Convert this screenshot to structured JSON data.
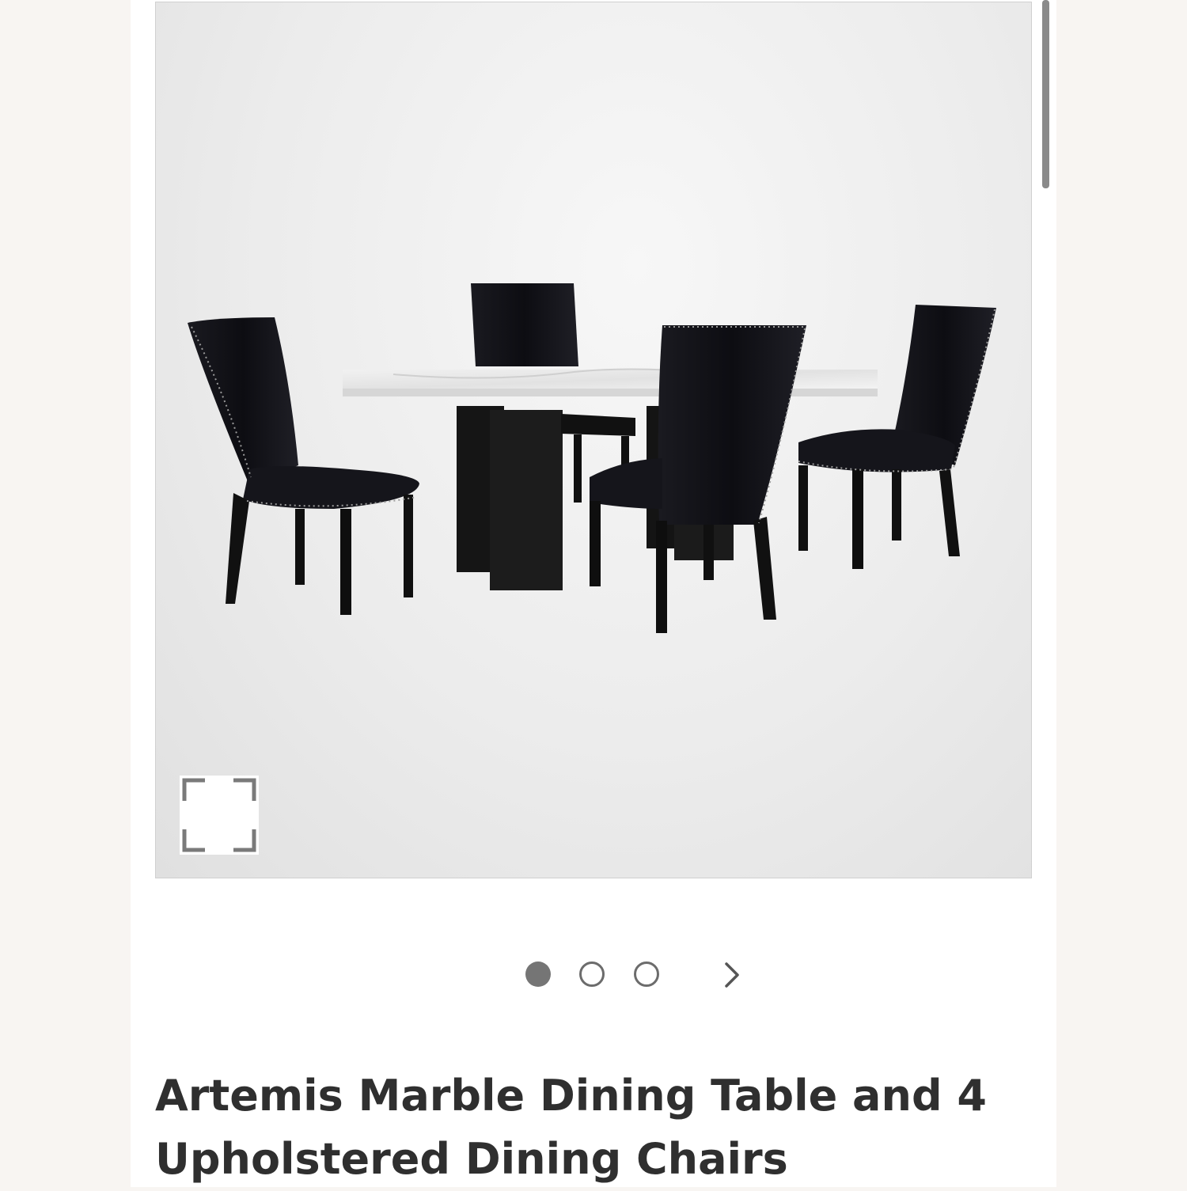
{
  "product": {
    "title": "Artemis Marble Dining Table and 4 Upholstered Dining Chairs",
    "image_alt": "Marble dining table with four black upholstered dining chairs"
  },
  "gallery": {
    "expand_icon": "expand-corners-icon",
    "next_icon": "chevron-right-icon",
    "slide_count": 3,
    "active_slide": 1
  },
  "colors": {
    "page_background": "#f8f5f2",
    "title_text": "#2f2f2f",
    "dot_active": "#757575"
  }
}
